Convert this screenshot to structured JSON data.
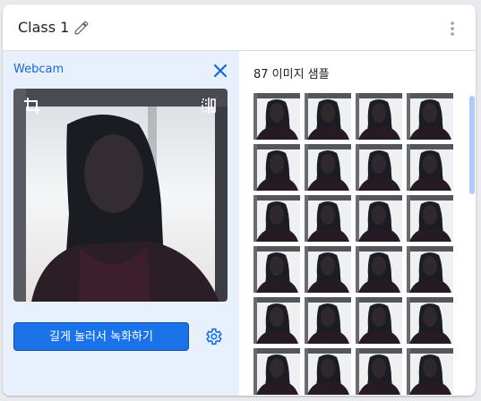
{
  "header": {
    "class_name": "Class 1",
    "edit_icon": "pencil-icon",
    "menu_icon": "more-vert-icon"
  },
  "webcam_panel": {
    "label": "Webcam",
    "close_icon": "close-icon",
    "crop_icon": "crop-icon",
    "flip_icon": "flip-icon",
    "record_button_label": "길게 눌러서 녹화하기",
    "settings_icon": "gear-icon"
  },
  "samples_panel": {
    "count_label": "87 이미지 샘플",
    "visible_thumbnail_count": 24
  },
  "colors": {
    "accent": "#1a73e8",
    "panel_bg": "#e8f0fe",
    "label_blue": "#1967d2",
    "scrollbar": "#aecbfa"
  }
}
